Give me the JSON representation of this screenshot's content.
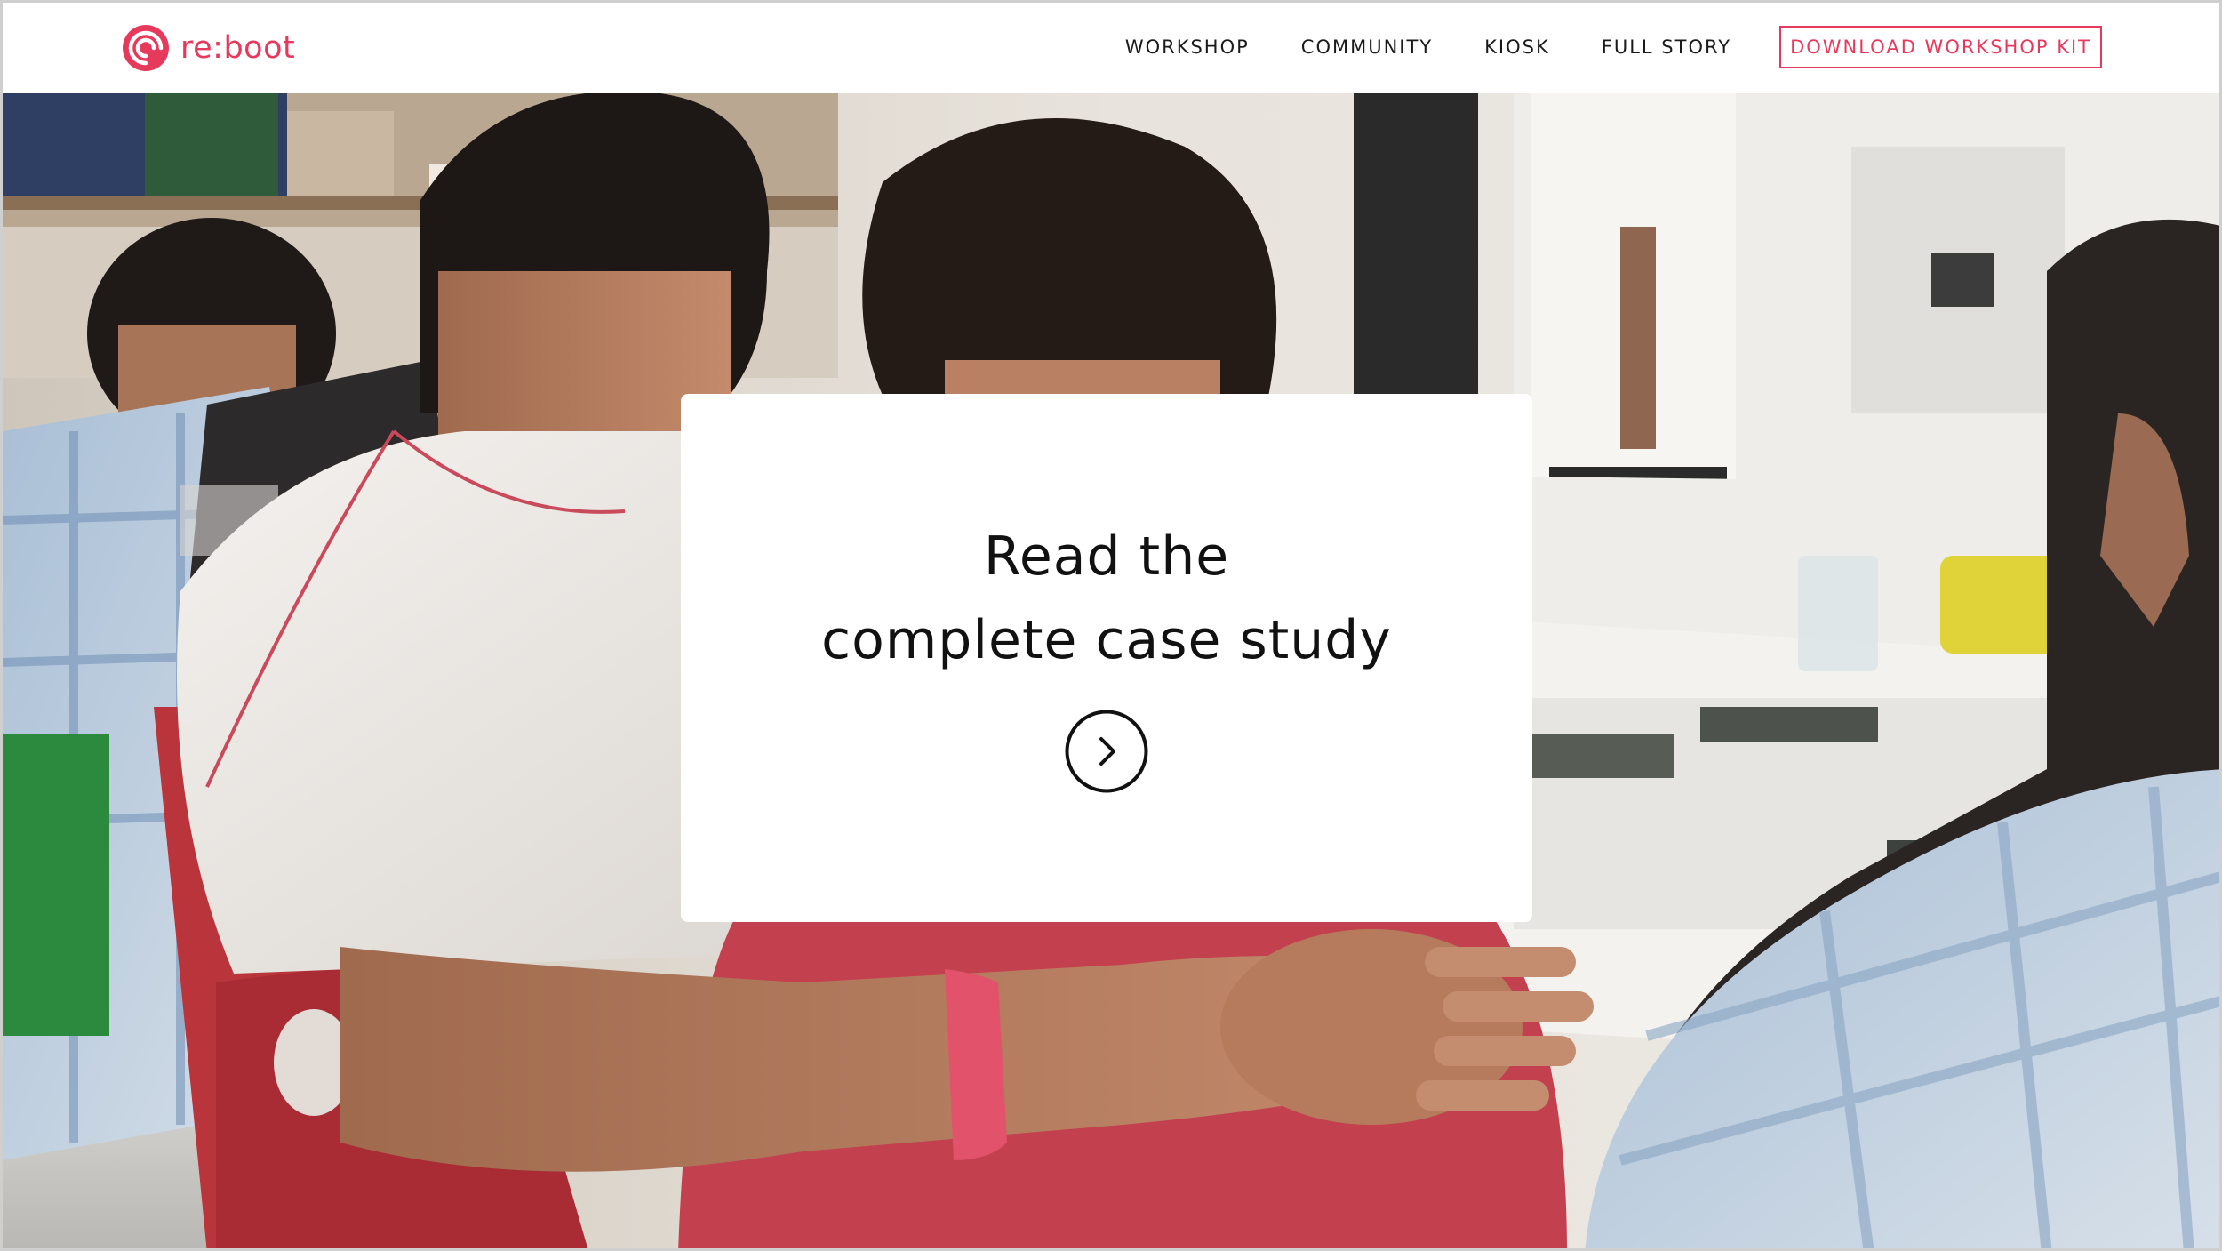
{
  "brand": {
    "name": "re:boot",
    "accent_color": "#e63a5c",
    "logo_icon": "spiral-logo-icon"
  },
  "nav": {
    "items": [
      {
        "label": "WORKSHOP"
      },
      {
        "label": "COMMUNITY"
      },
      {
        "label": "KIOSK"
      },
      {
        "label": "FULL STORY"
      }
    ],
    "cta_label": "DOWNLOAD WORKSHOP KIT"
  },
  "card": {
    "title_line1": "Read the",
    "title_line2": "complete case study",
    "arrow_icon": "chevron-right-circle-icon"
  }
}
